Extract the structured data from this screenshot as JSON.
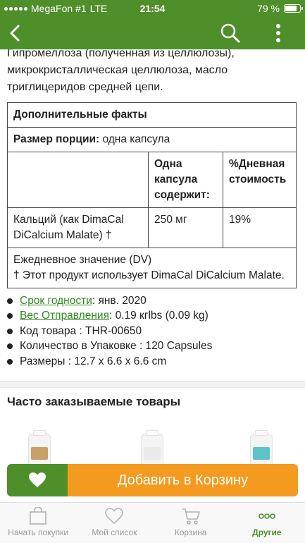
{
  "status": {
    "carrier": "MegaFon #1",
    "network": "LTE",
    "time": "21:54",
    "battery": "79 %",
    "battery_level": 0.79
  },
  "ingredients_lines": [
    "Гипромеллоза (полученная из целлюлозы),",
    "микрокристаллическая целлюлоза, масло",
    "триглицеридов средней цепи."
  ],
  "facts": {
    "title": "Дополнительные факты",
    "serving_label": "Размер порции:",
    "serving_value": " одна капсула",
    "col_amount": "Одна капсула содержит:",
    "col_dv": "%Дневная стоимость",
    "row_name": "Кальций (как DimaCal DiCalcium Malate) †",
    "row_amount": "250 мг",
    "row_dv": "19%",
    "footnote_dv": "Ежедневное значение (DV)",
    "footnote_dagger": "† Этот продукт использует DimaCal DiCalcium Malate."
  },
  "specs": {
    "expiry_link": "Срок годности",
    "expiry_value": " : янв. 2020",
    "weight_link": "Вес Отправления",
    "weight_value": " : 0.19 кгlbs (0.09 kg)",
    "code": "Код товара : THR-00650",
    "quantity": "Количество в Упаковке : 120 Capsules",
    "dimensions": "Размеры : 12.7 x 6.6 x 6.6 cm"
  },
  "frequently_ordered_title": "Часто заказываемые товары",
  "cart": {
    "add_label": "Добавить в Корзину"
  },
  "tabs": [
    {
      "label": "Начать покупки",
      "icon": "shopping-bag-icon"
    },
    {
      "label": "Мой список",
      "icon": "heart-icon"
    },
    {
      "label": "Корзина",
      "icon": "cart-icon"
    },
    {
      "label": "Другие",
      "icon": "more-dots-icon"
    }
  ],
  "colors": {
    "brand_green": "#4f8f2a",
    "cta_orange": "#f39a1f",
    "link_green": "#2e8b1f"
  }
}
